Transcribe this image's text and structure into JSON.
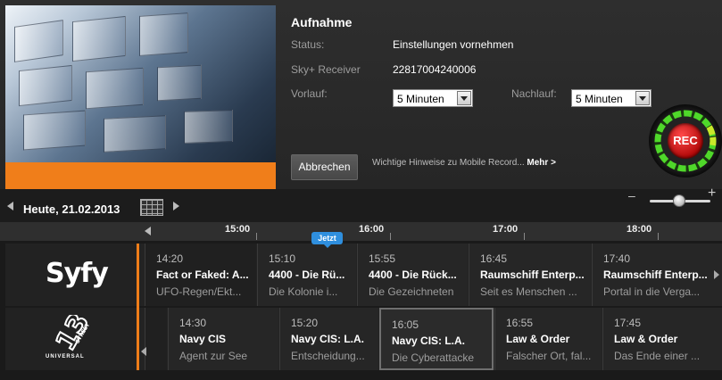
{
  "recording": {
    "title": "Aufnahme",
    "status_label": "Status:",
    "status_value": "Einstellungen vornehmen",
    "receiver_label": "Sky+ Receiver",
    "receiver_value": "22817004240006",
    "vorlauf_label": "Vorlauf:",
    "vorlauf_value": "5 Minuten",
    "nachlauf_label": "Nachlauf:",
    "nachlauf_value": "5 Minuten",
    "cancel_label": "Abbrechen",
    "hint_text": "Wichtige Hinweise zu Mobile Record...",
    "hint_more": "Mehr >",
    "rec_label": "REC"
  },
  "datebar": {
    "date": "Heute, 21.02.2013",
    "zoom_minus": "–",
    "zoom_plus": "+"
  },
  "timeline": {
    "ticks": [
      "15:00",
      "16:00",
      "17:00",
      "18:00"
    ],
    "now_label": "Jetzt"
  },
  "channels": [
    {
      "logo_text": "Syfy",
      "programs": [
        {
          "time": "14:20",
          "title": "Fact or Faked: A...",
          "subtitle": "UFO-Regen/Ekt..."
        },
        {
          "time": "15:10",
          "title": "4400 - Die Rü...",
          "subtitle": "Die Kolonie i..."
        },
        {
          "time": "15:55",
          "title": "4400 - Die Rück...",
          "subtitle": "Die Gezeichneten"
        },
        {
          "time": "16:45",
          "title": "Raumschiff Enterp...",
          "subtitle": "Seit es Menschen ..."
        },
        {
          "time": "17:40",
          "title": "Raumschiff Enterp...",
          "subtitle": "Portal in die Verga..."
        }
      ]
    },
    {
      "logo_text": "13",
      "logo_sub": "UNIVERSAL",
      "logo_side": "STREET",
      "programs": [
        {
          "time": "14:30",
          "title": "Navy CIS",
          "subtitle": "Agent zur See"
        },
        {
          "time": "15:20",
          "title": "Navy CIS: L.A.",
          "subtitle": "Entscheidung..."
        },
        {
          "time": "16:05",
          "title": "Navy CIS: L.A.",
          "subtitle": "Die Cyberattacke"
        },
        {
          "time": "16:55",
          "title": "Law & Order",
          "subtitle": "Falscher Ort, fal..."
        },
        {
          "time": "17:45",
          "title": "Law & Order",
          "subtitle": "Das Ende einer ..."
        }
      ]
    }
  ],
  "colors": {
    "accent_orange": "#ef7d19",
    "now_blue": "#2f8fde",
    "rec_red": "#d01010",
    "rec_ring_green": "#4fd82a"
  }
}
